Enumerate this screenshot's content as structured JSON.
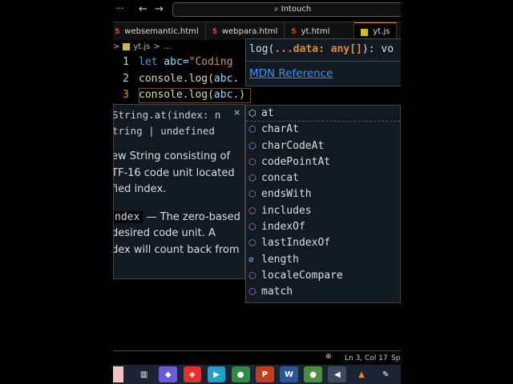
{
  "titlebar": {
    "more": "···",
    "back": "←",
    "forward": "→",
    "search_icon": "⌕",
    "search": "Intouch"
  },
  "tabs": [
    {
      "label": "websemantic.html",
      "icon": "html"
    },
    {
      "label": "webpara.html",
      "icon": "html"
    },
    {
      "label": "yt.html",
      "icon": "html"
    },
    {
      "label": "yt.js",
      "icon": "js",
      "active": true
    }
  ],
  "breadcrumb": {
    "sep": ">",
    "file": "yt.js",
    "more": "..."
  },
  "code": [
    {
      "n": "1",
      "kw": "let",
      "rest": " abc=",
      "str": "\"Coding"
    },
    {
      "n": "2",
      "fn": "console.log(",
      "var": "abc."
    },
    {
      "n": "3",
      "fn": "console.log(",
      "var": "abc.",
      "close": ")"
    }
  ],
  "param_hint": {
    "pre": "log(",
    "param": "...data: any[]",
    "post": "): vo",
    "link": "MDN Reference"
  },
  "hover": {
    "sig1": "String.at(index: n",
    "sig2": "tring | undefined",
    "close": "×",
    "doc": [
      "ew String consisting of",
      "TF-16 code unit located",
      "fied index."
    ],
    "param_code": "ndex",
    "param_rest": " — The zero-based",
    "doc2": [
      " desired code unit. A",
      "dex will count back from",
      "."
    ]
  },
  "suggestions": [
    {
      "label": "at",
      "kind": "method"
    },
    {
      "label": "charAt",
      "kind": "method"
    },
    {
      "label": "charCodeAt",
      "kind": "method"
    },
    {
      "label": "codePointAt",
      "kind": "method"
    },
    {
      "label": "concat",
      "kind": "method"
    },
    {
      "label": "endsWith",
      "kind": "method"
    },
    {
      "label": "includes",
      "kind": "method"
    },
    {
      "label": "indexOf",
      "kind": "method"
    },
    {
      "label": "lastIndexOf",
      "kind": "method"
    },
    {
      "label": "length",
      "kind": "field"
    },
    {
      "label": "localeCompare",
      "kind": "method"
    },
    {
      "label": "match",
      "kind": "method"
    }
  ],
  "status": {
    "zoom_icon": "⊕",
    "position": "Ln 3, Col 17",
    "spaces": "Sp"
  },
  "taskbar": [
    {
      "name": "task-view",
      "glyph": "▥",
      "color": "#1c2433"
    },
    {
      "name": "copilot",
      "glyph": "◆",
      "color": "#6b5bd6"
    },
    {
      "name": "anydesk",
      "glyph": "◈",
      "color": "#e0322b"
    },
    {
      "name": "remote",
      "glyph": "▶",
      "color": "#1fa1c4"
    },
    {
      "name": "chrome",
      "glyph": "●",
      "color": "#2e8b45"
    },
    {
      "name": "powerpoint",
      "glyph": "P",
      "color": "#c43e1c"
    },
    {
      "name": "word",
      "glyph": "W",
      "color": "#2b579a"
    },
    {
      "name": "chrome-profile",
      "glyph": "●",
      "color": "#4a8f3c"
    },
    {
      "name": "vscode",
      "glyph": "◀",
      "color": "#3d4a5e"
    },
    {
      "name": "vlc",
      "glyph": "▲",
      "color": "#1c2433"
    },
    {
      "name": "paint",
      "glyph": "✎",
      "color": "#1c2433"
    }
  ],
  "colors": {
    "accent": "#e08a3c",
    "link": "#3794ff",
    "method_icon": "#b180d7",
    "field_icon": "#75beff"
  }
}
